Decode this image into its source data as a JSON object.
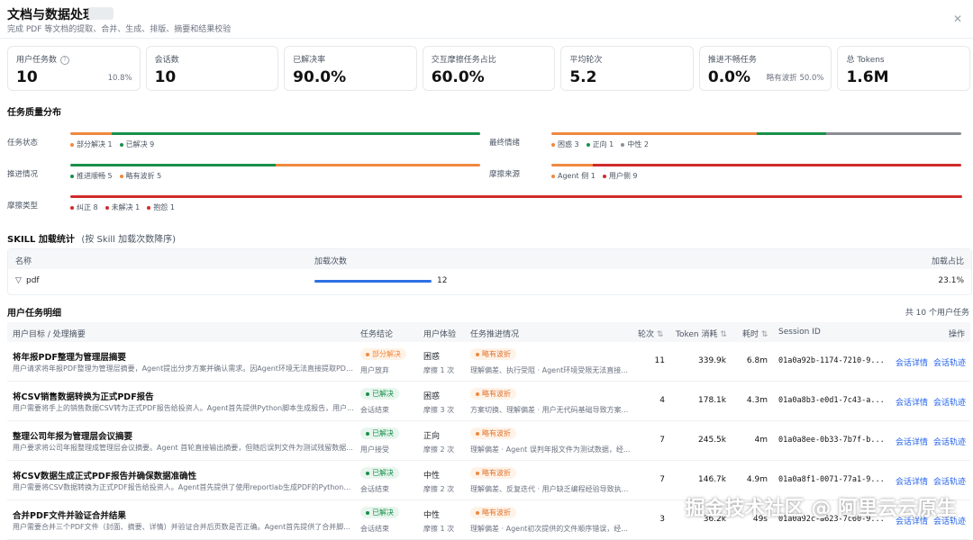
{
  "header": {
    "title": "文档与数据处理",
    "subtitle": "完成 PDF 等文档的提取、合并、生成、排版、摘要和结果校验",
    "close_icon": "close-icon"
  },
  "stats": [
    {
      "label": "用户任务数",
      "value": "10",
      "note": "10.8%",
      "has_help": true
    },
    {
      "label": "会话数",
      "value": "10",
      "note": ""
    },
    {
      "label": "已解决率",
      "value": "90.0%",
      "note": ""
    },
    {
      "label": "交互摩擦任务占比",
      "value": "60.0%",
      "note": ""
    },
    {
      "label": "平均轮次",
      "value": "5.2",
      "note": ""
    },
    {
      "label": "推进不畅任务",
      "value": "0.0%",
      "note": "略有波折 50.0%"
    },
    {
      "label": "总 Tokens",
      "value": "1.6M",
      "note": ""
    }
  ],
  "quality": {
    "title": "任务质量分布",
    "groups": [
      {
        "label": "任务状态",
        "legend": [
          {
            "text": "部分解决 1",
            "color": "#f0883e",
            "share": 0.1
          },
          {
            "text": "已解决 9",
            "color": "#1a8f4c",
            "share": 0.9
          }
        ]
      },
      {
        "label": "最终情绪",
        "legend": [
          {
            "text": "困惑 3",
            "color": "#f0883e",
            "share": 0.5
          },
          {
            "text": "正向 1",
            "color": "#1a8f4c",
            "share": 0.17
          },
          {
            "text": "中性 2",
            "color": "#8b8f94",
            "share": 0.33
          }
        ]
      },
      {
        "label": "推进情况",
        "legend": [
          {
            "text": "推进顺畅 5",
            "color": "#1a8f4c",
            "share": 0.5
          },
          {
            "text": "略有波折 5",
            "color": "#f0883e",
            "share": 0.5
          }
        ]
      },
      {
        "label": "摩擦来源",
        "legend": [
          {
            "text": "Agent 侧 1",
            "color": "#f0883e",
            "share": 0.1
          },
          {
            "text": "用户侧 9",
            "color": "#d12b2b",
            "share": 0.9
          }
        ]
      },
      {
        "label": "摩擦类型",
        "legend": [
          {
            "text": "纠正 8",
            "color": "#d12b2b",
            "share": 0.8
          },
          {
            "text": "未解决 1",
            "color": "#d12b2b",
            "share": 0.1
          },
          {
            "text": "抱怨 1",
            "color": "#d12b2b",
            "share": 0.1
          }
        ]
      }
    ]
  },
  "skill": {
    "title": "SKILL 加载统计",
    "title_note": "(按 Skill 加载次数降序)",
    "columns": [
      "名称",
      "加载次数",
      "加载占比"
    ],
    "rows": [
      {
        "name": "pdf",
        "count": "12",
        "share": "23.1%",
        "fill": 1.0,
        "icon": "filter-icon"
      }
    ]
  },
  "tasks": {
    "title": "用户任务明细",
    "total": "共 10 个用户任务",
    "columns": [
      "用户目标 / 处理摘要",
      "任务结论",
      "用户体验",
      "任务推进情况",
      "轮次",
      "Token 消耗",
      "耗时",
      "Session ID",
      "操作"
    ],
    "rows": [
      {
        "goal": "将年报PDF整理为管理层摘要",
        "summary": "用户请求将年报PDF整理为管理层摘要，Agent提出分步方案并确认需求。因Agent环境无法直接提取PDF...",
        "status": "部分解决",
        "status_color": "#f0883e",
        "status_bg": "#fff3e8",
        "status_sub": "用户放弃",
        "experience": "困惑",
        "friction": "摩擦 1 次",
        "progress": "略有波折",
        "progress_detail": "理解偏差、执行受阻 · Agent环境受限无法直接...",
        "turns": "11",
        "tokens": "339.9k",
        "duration": "6.8m",
        "session": "01a0a92b-1174-7210-9...",
        "actions": [
          "会话详情",
          "会话轨迹"
        ]
      },
      {
        "goal": "将CSV销售数据转换为正式PDF报告",
        "summary": "用户需要将手上的销售数据CSV转为正式PDF报告给投资人。Agent首先提供Python脚本生成报告，用户...",
        "status": "已解决",
        "status_color": "#1a8f4c",
        "status_bg": "#e8f6ee",
        "status_sub": "会话结束",
        "experience": "困惑",
        "friction": "摩擦 3 次",
        "progress": "略有波折",
        "progress_detail": "方案切换、理解偏差 · 用户无代码基础导致方案...",
        "turns": "4",
        "tokens": "178.1k",
        "duration": "4.3m",
        "session": "01a0a8b3-e0d1-7c43-a...",
        "actions": [
          "会话详情",
          "会话轨迹"
        ]
      },
      {
        "goal": "整理公司年报为管理层会议摘要",
        "summary": "用户要求将公司年报整理成管理层会议摘要。Agent 首轮直接输出摘要，但随后误判文件为测试残留数据...",
        "status": "已解决",
        "status_color": "#1a8f4c",
        "status_bg": "#e8f6ee",
        "status_sub": "用户接受",
        "experience": "正向",
        "friction": "摩擦 2 次",
        "progress": "略有波折",
        "progress_detail": "理解偏差 · Agent 误判年报文件为测试数据，经...",
        "turns": "7",
        "tokens": "245.5k",
        "duration": "4m",
        "session": "01a0a8ee-0b33-7b7f-b...",
        "actions": [
          "会话详情",
          "会话轨迹"
        ]
      },
      {
        "goal": "将CSV数据生成正式PDF报告并确保数据准确性",
        "summary": "用户需要将CSV数据转换为正式PDF报告给投资人。Agent首先提供了使用reportlab生成PDF的Python脚...",
        "status": "已解决",
        "status_color": "#1a8f4c",
        "status_bg": "#e8f6ee",
        "status_sub": "会话结束",
        "experience": "中性",
        "friction": "摩擦 2 次",
        "progress": "略有波折",
        "progress_detail": "理解偏差、反复迭代 · 用户缺乏编程经验导致执...",
        "turns": "7",
        "tokens": "146.7k",
        "duration": "4.9m",
        "session": "01a0a8f1-0071-77a1-9...",
        "actions": [
          "会话详情",
          "会话轨迹"
        ]
      },
      {
        "goal": "合并PDF文件并验证合并结果",
        "summary": "用户需要合并三个PDF文件（封面、摘要、详情）并验证合并后页数是否正确。Agent首先提供了合并脚...",
        "status": "已解决",
        "status_color": "#1a8f4c",
        "status_bg": "#e8f6ee",
        "status_sub": "会话结束",
        "experience": "中性",
        "friction": "摩擦 1 次",
        "progress": "略有波折",
        "progress_detail": "理解偏差 · Agent初次提供的文件顺序错误，经...",
        "turns": "3",
        "tokens": "36.2k",
        "duration": "49s",
        "session": "01a0a92c-a623-7c60-9...",
        "actions": [
          "会话详情",
          "会话轨迹"
        ]
      }
    ]
  },
  "watermark": "掘金技术社区 @ 阿里云云原生"
}
